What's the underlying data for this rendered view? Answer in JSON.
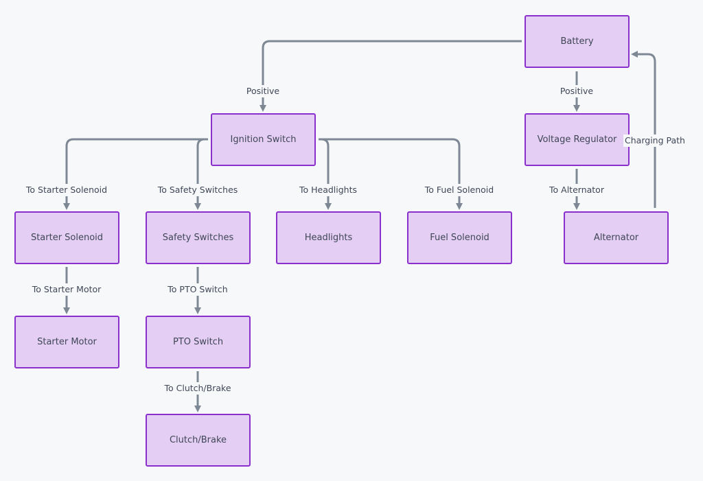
{
  "diagram": {
    "type": "flowchart",
    "direction": "top-down",
    "colors": {
      "background": "#f7f8fa",
      "node_fill": "#e4cef4",
      "node_border": "#8a2fcc",
      "edge": "#7d8894",
      "text": "#3f4656"
    },
    "nodes": [
      {
        "id": "battery",
        "label": "Battery"
      },
      {
        "id": "ignition",
        "label": "Ignition Switch"
      },
      {
        "id": "regulator",
        "label": "Voltage Regulator"
      },
      {
        "id": "starter_solenoid",
        "label": "Starter Solenoid"
      },
      {
        "id": "safety",
        "label": "Safety Switches"
      },
      {
        "id": "headlights",
        "label": "Headlights"
      },
      {
        "id": "fuel_solenoid",
        "label": "Fuel Solenoid"
      },
      {
        "id": "alternator",
        "label": "Alternator"
      },
      {
        "id": "starter_motor",
        "label": "Starter Motor"
      },
      {
        "id": "pto",
        "label": "PTO Switch"
      },
      {
        "id": "clutch",
        "label": "Clutch/Brake"
      }
    ],
    "edges": [
      {
        "from": "battery",
        "to": "ignition",
        "label": "Positive"
      },
      {
        "from": "battery",
        "to": "regulator",
        "label": "Positive"
      },
      {
        "from": "ignition",
        "to": "starter_solenoid",
        "label": "To Starter Solenoid"
      },
      {
        "from": "ignition",
        "to": "safety",
        "label": "To Safety Switches"
      },
      {
        "from": "ignition",
        "to": "headlights",
        "label": "To Headlights"
      },
      {
        "from": "ignition",
        "to": "fuel_solenoid",
        "label": "To Fuel Solenoid"
      },
      {
        "from": "regulator",
        "to": "alternator",
        "label": "To Alternator"
      },
      {
        "from": "alternator",
        "to": "battery",
        "label": "Charging Path"
      },
      {
        "from": "starter_solenoid",
        "to": "starter_motor",
        "label": "To Starter Motor"
      },
      {
        "from": "safety",
        "to": "pto",
        "label": "To PTO Switch"
      },
      {
        "from": "pto",
        "to": "clutch",
        "label": "To Clutch/Brake"
      }
    ]
  }
}
